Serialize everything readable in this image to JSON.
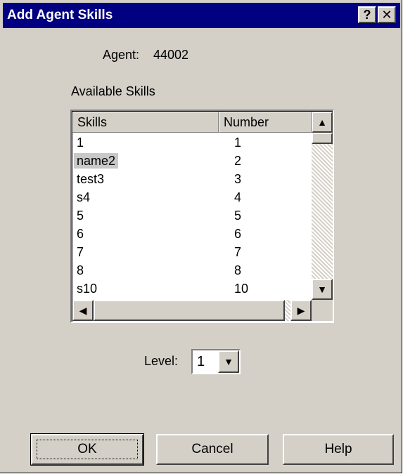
{
  "window": {
    "title": "Add Agent Skills",
    "help_btn": "?",
    "close_btn": "✕"
  },
  "agent": {
    "label": "Agent:",
    "value": "44002"
  },
  "available_skills_label": "Available Skills",
  "table": {
    "headers": [
      "Skills",
      "Number"
    ],
    "rows": [
      {
        "skill": "1",
        "number": "1"
      },
      {
        "skill": "name2",
        "number": "2",
        "selected": true
      },
      {
        "skill": "test3",
        "number": "3"
      },
      {
        "skill": "s4",
        "number": "4"
      },
      {
        "skill": "5",
        "number": "5"
      },
      {
        "skill": "6",
        "number": "6"
      },
      {
        "skill": "7",
        "number": "7"
      },
      {
        "skill": "8",
        "number": "8"
      },
      {
        "skill": "s10",
        "number": "10"
      }
    ]
  },
  "scroll_icons": {
    "up": "▲",
    "down": "▼",
    "left": "◀",
    "right": "▶"
  },
  "level": {
    "label": "Level:",
    "value": "1",
    "arrow": "▼"
  },
  "buttons": {
    "ok": "OK",
    "cancel": "Cancel",
    "help": "Help"
  }
}
